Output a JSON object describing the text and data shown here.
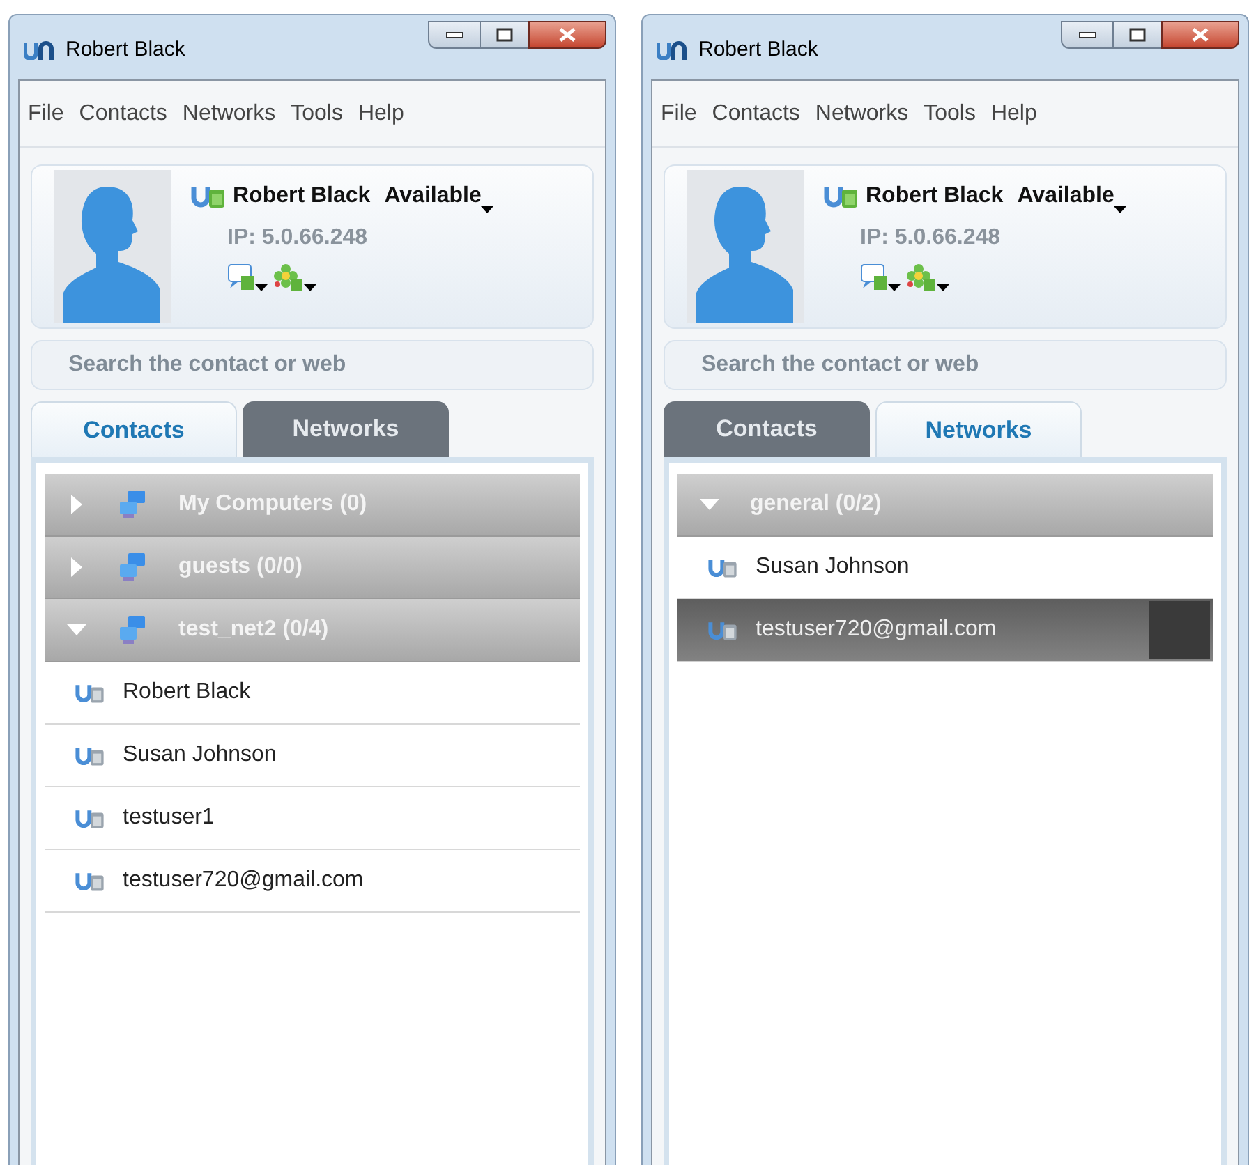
{
  "windows": [
    {
      "title": "Robert Black",
      "menu": [
        "File",
        "Contacts",
        "Networks",
        "Tools",
        "Help"
      ],
      "profile": {
        "name": "Robert Black",
        "status": "Available",
        "ip": "IP: 5.0.66.248"
      },
      "search": {
        "placeholder": "Search the contact or web"
      },
      "tabs": [
        {
          "label": "Contacts",
          "selected": true
        },
        {
          "label": "Networks",
          "selected": false
        }
      ],
      "groups": [
        {
          "kind": "network",
          "name": "My Computers (0)",
          "expanded": false
        },
        {
          "kind": "network",
          "name": "guests (0/0)",
          "expanded": false
        },
        {
          "kind": "network",
          "name": "test_net2 (0/4)",
          "expanded": true,
          "contacts": [
            {
              "name": "Robert Black",
              "selected": false,
              "avatar": false
            },
            {
              "name": "Susan Johnson",
              "selected": false,
              "avatar": false
            },
            {
              "name": "testuser1",
              "selected": false,
              "avatar": false
            },
            {
              "name": "testuser720@gmail.com",
              "selected": false,
              "avatar": false
            }
          ]
        }
      ]
    },
    {
      "title": "Robert Black",
      "menu": [
        "File",
        "Contacts",
        "Networks",
        "Tools",
        "Help"
      ],
      "profile": {
        "name": "Robert Black",
        "status": "Available",
        "ip": "IP: 5.0.66.248"
      },
      "search": {
        "placeholder": "Search the contact or web"
      },
      "tabs": [
        {
          "label": "Contacts",
          "selected": false
        },
        {
          "label": "Networks",
          "selected": true
        }
      ],
      "groups": [
        {
          "kind": "plain",
          "name": "general (0/2)",
          "expanded": true,
          "contacts": [
            {
              "name": "Susan Johnson",
              "selected": false,
              "avatar": false
            },
            {
              "name": "testuser720@gmail.com",
              "selected": true,
              "avatar": true
            }
          ]
        }
      ]
    }
  ]
}
